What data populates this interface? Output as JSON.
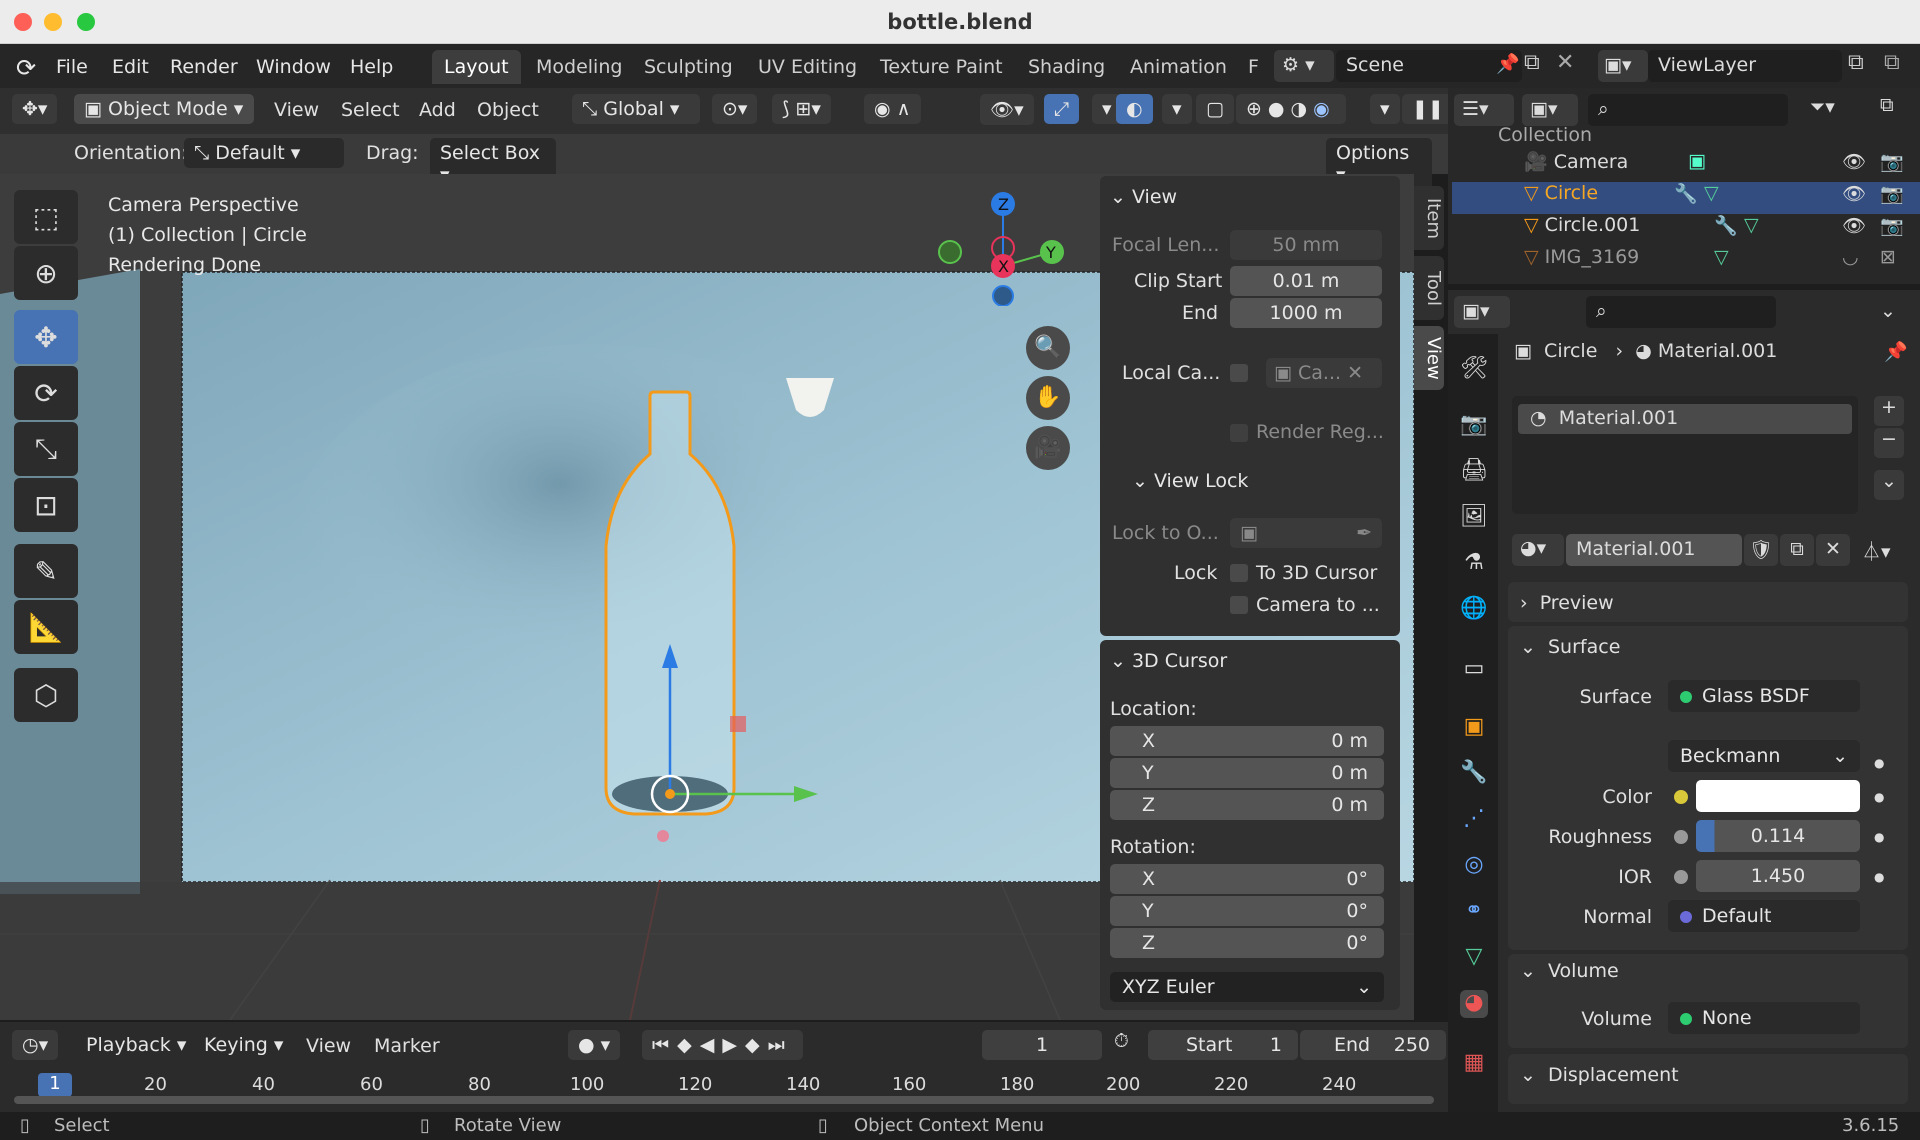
{
  "window": {
    "title": "bottle.blend"
  },
  "menu": {
    "file": "File",
    "edit": "Edit",
    "render": "Render",
    "window": "Window",
    "help": "Help"
  },
  "workspaces": {
    "layout": "Layout",
    "modeling": "Modeling",
    "sculpting": "Sculpting",
    "uv": "UV Editing",
    "texture": "Texture Paint",
    "shading": "Shading",
    "animation": "Animation",
    "more": "F"
  },
  "scene": {
    "name": "Scene",
    "view_layer": "ViewLayer"
  },
  "header": {
    "mode": "Object Mode",
    "view": "View",
    "select": "Select",
    "add": "Add",
    "object": "Object",
    "transform": "Global"
  },
  "tool_settings": {
    "orientation_label": "Orientation:",
    "orientation_value": "Default",
    "drag_label": "Drag:",
    "drag_value": "Select Box",
    "options": "Options"
  },
  "viewport": {
    "line1": "Camera Perspective",
    "line2": "(1) Collection | Circle",
    "line3": "Rendering Done",
    "gizmo_x": "X",
    "gizmo_y": "Y",
    "gizmo_z": "Z"
  },
  "npanel": {
    "tabs": {
      "item": "Item",
      "tool": "Tool",
      "view": "View"
    },
    "view": {
      "title": "View",
      "focal_label": "Focal Len...",
      "focal_value": "50 mm",
      "clip_start_label": "Clip Start",
      "clip_start_value": "0.01 m",
      "end_label": "End",
      "end_value": "1000 m",
      "local_cam_label": "Local Ca...",
      "local_cam_value": "Ca...",
      "render_region": "Render Reg...",
      "view_lock_title": "View Lock",
      "lock_to_label": "Lock to O...",
      "lock_label": "Lock",
      "to_cursor": "To 3D Cursor",
      "camera_to": "Camera to ..."
    },
    "cursor": {
      "title": "3D Cursor",
      "location_label": "Location:",
      "lx": "X",
      "lx_v": "0 m",
      "ly": "Y",
      "ly_v": "0 m",
      "lz": "Z",
      "lz_v": "0 m",
      "rotation_label": "Rotation:",
      "rx": "X",
      "rx_v": "0°",
      "ry": "Y",
      "ry_v": "0°",
      "rz": "Z",
      "rz_v": "0°",
      "mode": "XYZ Euler"
    }
  },
  "outliner": {
    "collection": "Collection",
    "items": [
      {
        "name": "Camera"
      },
      {
        "name": "Circle"
      },
      {
        "name": "Circle.001"
      },
      {
        "name": "IMG_3169"
      }
    ]
  },
  "properties": {
    "breadcrumb_object": "Circle",
    "breadcrumb_material": "Material.001",
    "slot": "Material.001",
    "material_name": "Material.001",
    "sections": {
      "preview": "Preview",
      "surface": "Surface",
      "volume": "Volume",
      "displacement": "Displacement"
    },
    "surface": {
      "surface_label": "Surface",
      "surface_value": "Glass BSDF",
      "distribution": "Beckmann",
      "color_label": "Color",
      "color_hex": "#ffffff",
      "roughness_label": "Roughness",
      "roughness_value": "0.114",
      "ior_label": "IOR",
      "ior_value": "1.450",
      "normal_label": "Normal",
      "normal_value": "Default"
    },
    "volume": {
      "volume_label": "Volume",
      "volume_value": "None"
    }
  },
  "timeline": {
    "playback": "Playback",
    "keying": "Keying",
    "view": "View",
    "marker": "Marker",
    "current_frame": "1",
    "start_label": "Start",
    "start": "1",
    "end_label": "End",
    "end": "250",
    "ruler": [
      "1",
      "20",
      "40",
      "60",
      "80",
      "100",
      "120",
      "140",
      "160",
      "180",
      "200",
      "220",
      "240"
    ]
  },
  "status": {
    "select": "Select",
    "rotate": "Rotate View",
    "context": "Object Context Menu",
    "version": "3.6.15"
  },
  "colors": {
    "accent": "#4772b3",
    "selection_orange": "#f39a1a",
    "viewport_bg": "#a8c8d6"
  }
}
